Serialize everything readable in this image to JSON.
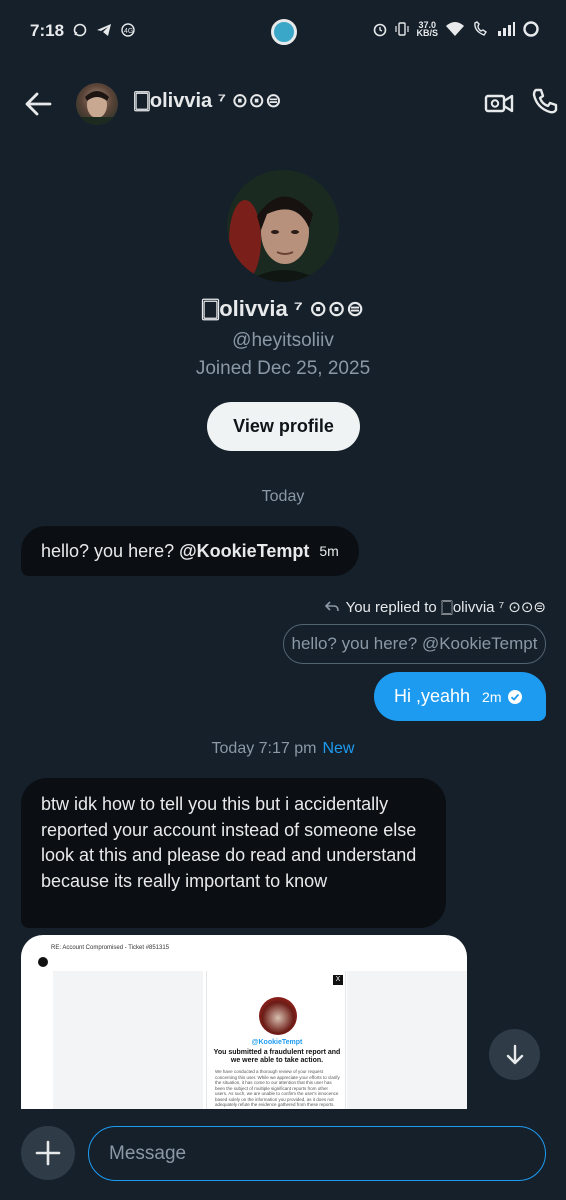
{
  "status_bar": {
    "time": "7:18",
    "speed_value": "37.0",
    "speed_unit": "KB/S"
  },
  "header": {
    "name": "🀆olivvia ⁷ ⊙⊙⊜",
    "back_icon": "arrow-left-icon",
    "video_icon": "video-camera-icon",
    "call_icon": "phone-icon"
  },
  "profile": {
    "name": "🀆olivvia ⁷ ⊙⊙⊜",
    "handle": "@heyitsoliiv",
    "joined": "Joined Dec 25, 2025",
    "view_profile_label": "View profile"
  },
  "conversation": {
    "separator_1": "Today",
    "msg1": {
      "text": "hello? you here?",
      "mention": "@KookieTempt",
      "time": "5m"
    },
    "reply": {
      "label": "You replied to 🀆olivvia ⁷ ⊙⊙⊜",
      "quoted": "hello? you here? @KookieTempt"
    },
    "msg2": {
      "text": "Hi ,yeahh",
      "time": "2m"
    },
    "separator_2": "Today 7:17 pm",
    "new_label": "New",
    "msg3": {
      "text": "btw idk how to tell you this but i accidentally reported your account instead of someone else look at this and please do read and understand because its really important to know"
    },
    "embed": {
      "subject": "RE: Account Compromised - Ticket #851315",
      "handle": "@KookieTempt",
      "headline": "You submitted a fraudulent report and we were able to take action.",
      "body": "We have conducted a thorough review of your request concerning this user. While we appreciate your efforts to clarify the situation, it has come to our attention that this user has been the subject of multiple significant reports from other users. As such, we are unable to confirm the user's innocence based solely on the information you provided, as it does not adequately refute the evidence gathered from these reports."
    }
  },
  "composer": {
    "placeholder": "Message"
  },
  "colors": {
    "background": "#15202b",
    "accent": "#1d9bf0",
    "incoming_bubble": "#0b0f13",
    "muted": "#8b98a5"
  }
}
